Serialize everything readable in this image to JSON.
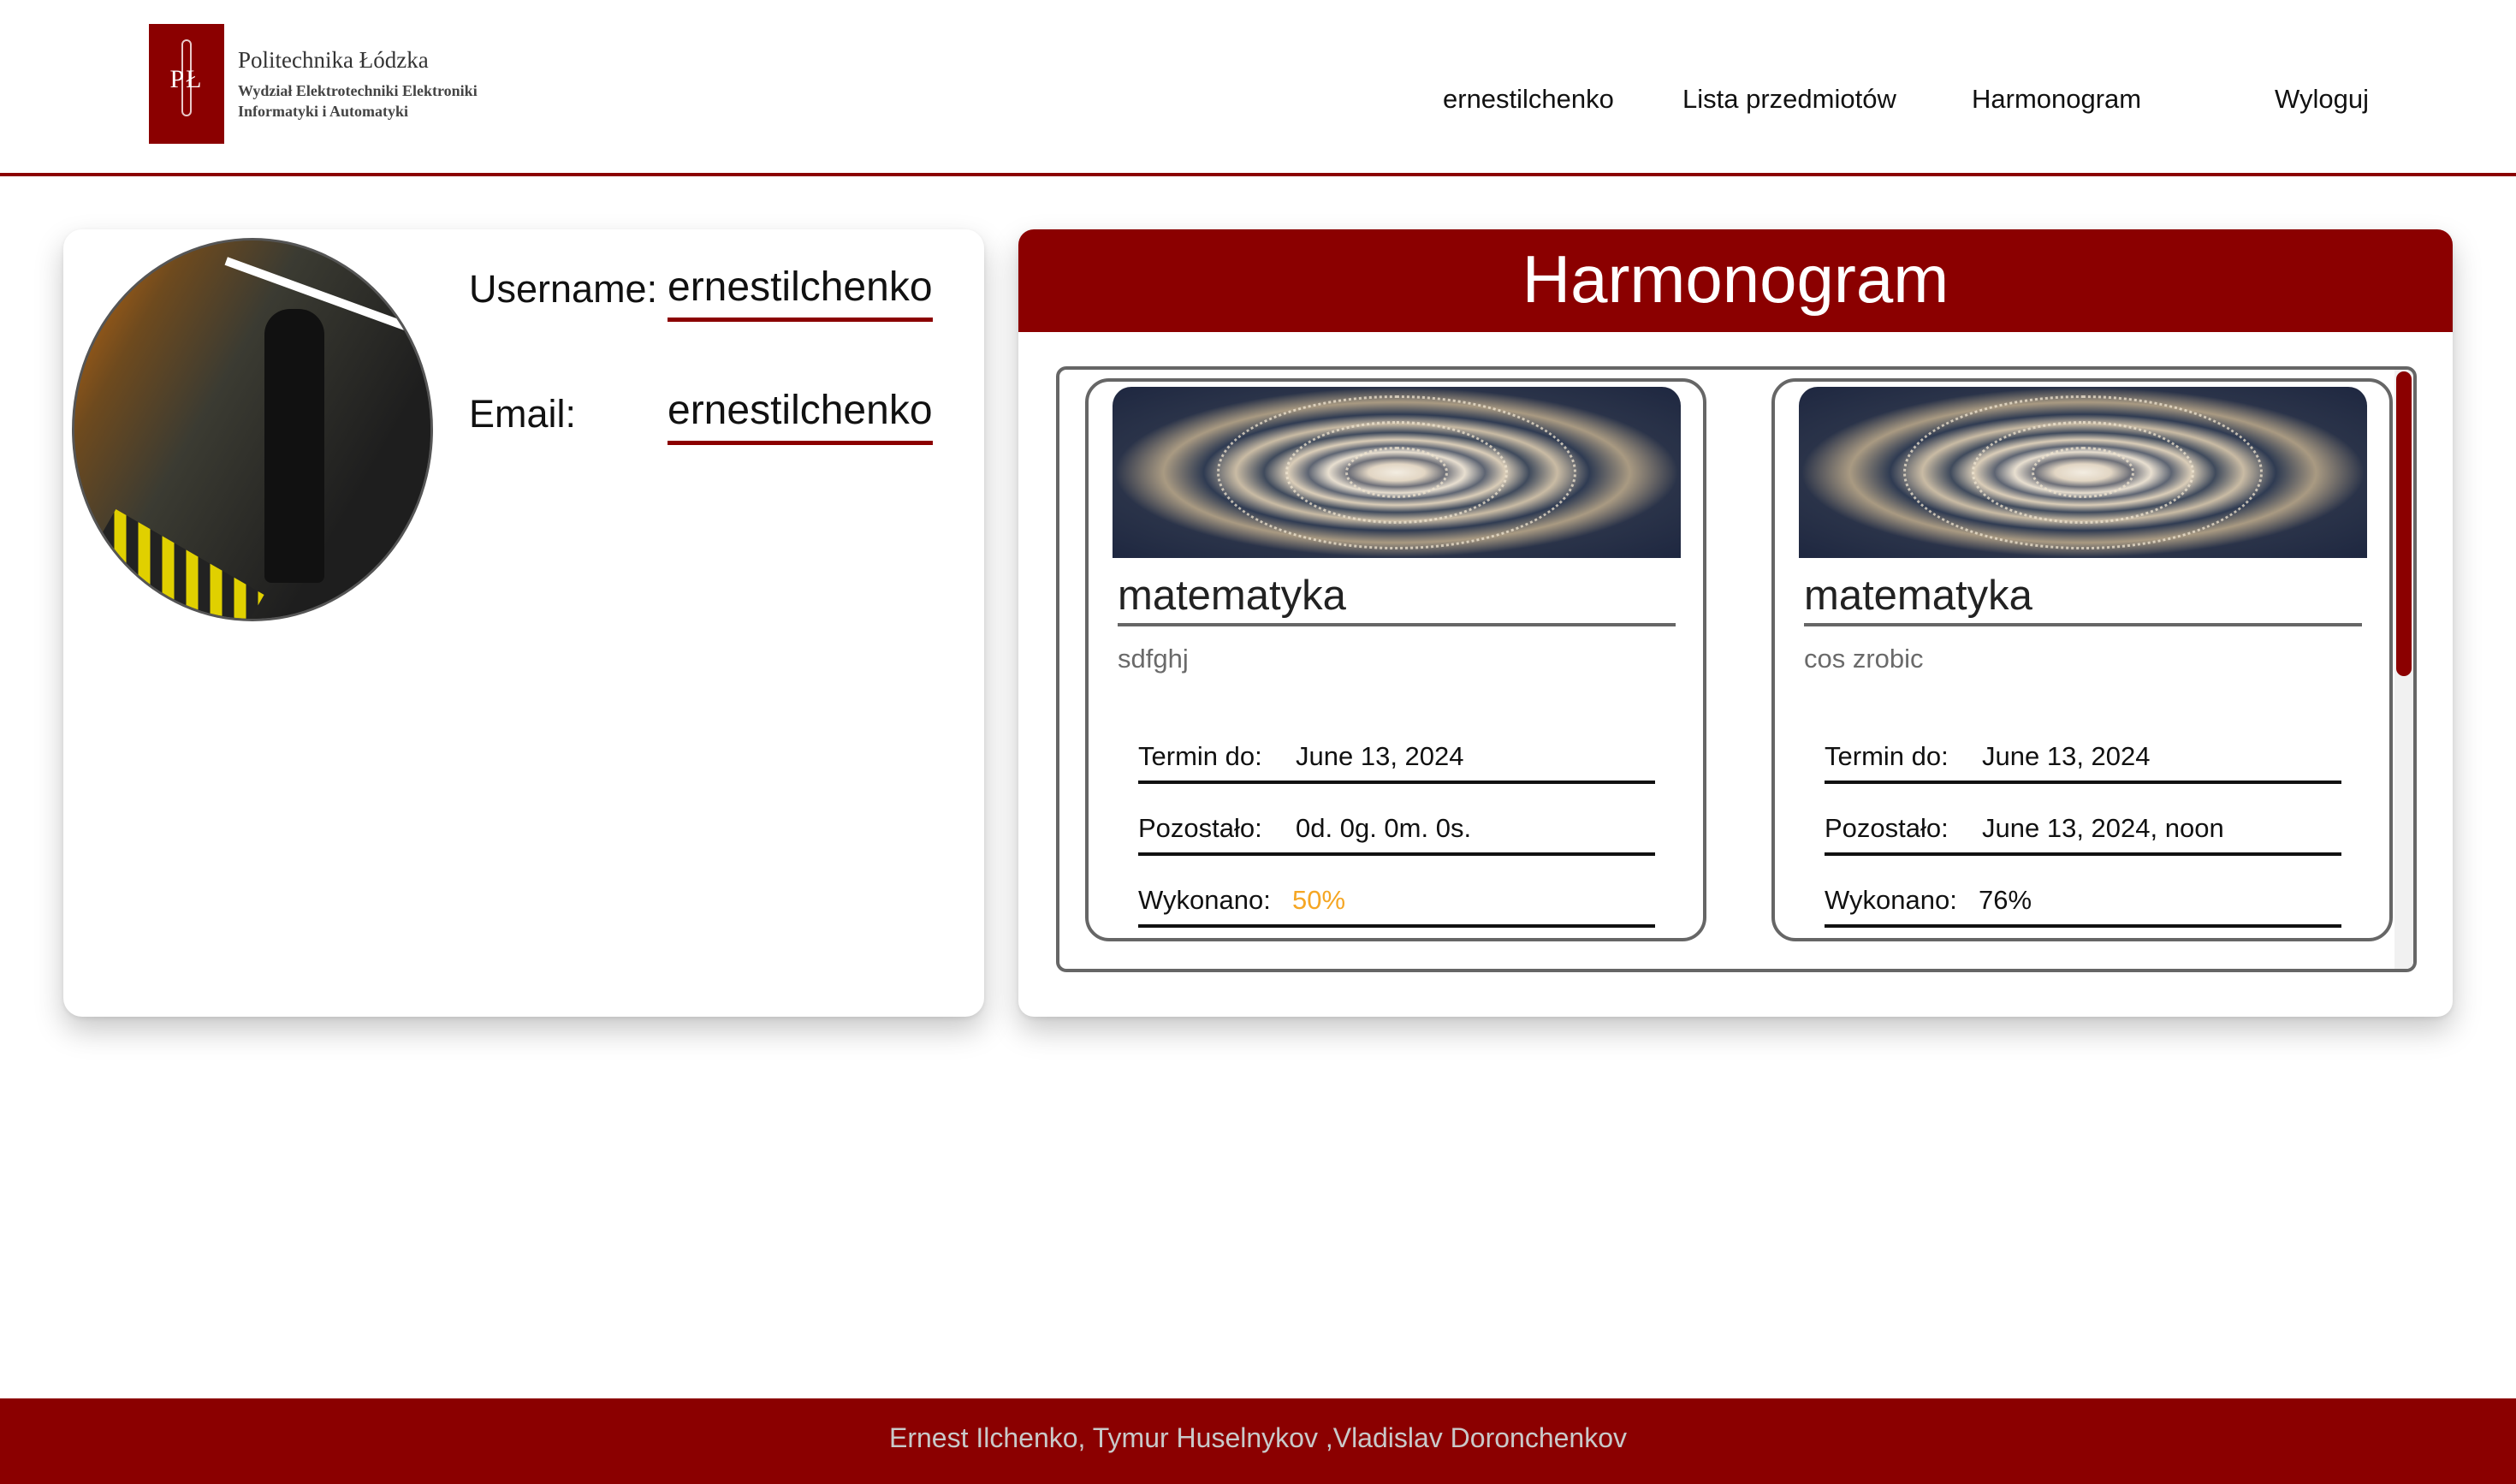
{
  "header": {
    "logo": {
      "name": "Politechnika Łódzka",
      "line2": "Wydział Elektrotechniki Elektroniki",
      "line3": "Informatyki i Automatyki",
      "mark": "PŁ"
    },
    "nav": {
      "username": "ernestilchenko",
      "subjects": "Lista przedmiotów",
      "schedule": "Harmonogram",
      "logout": "Wyloguj"
    }
  },
  "profile": {
    "username_label": "Username:",
    "username_value": "ernestilchenko",
    "email_label": "Email:",
    "email_value": "ernestilchenko"
  },
  "schedule": {
    "title": "Harmonogram",
    "tasks": [
      {
        "title": "matematyka",
        "description": "sdfghj",
        "deadline_label": "Termin do:",
        "deadline_value": "June 13, 2024",
        "remaining_label": "Pozostało:",
        "remaining_value": "0d. 0g. 0m. 0s.",
        "done_label": "Wykonano:",
        "done_value": "50%"
      },
      {
        "title": "matematyka",
        "description": "cos zrobic",
        "deadline_label": "Termin do:",
        "deadline_value": "June 13, 2024",
        "remaining_label": "Pozostało:",
        "remaining_value": "June 13, 2024, noon",
        "done_label": "Wykonano:",
        "done_value": "76%"
      }
    ]
  },
  "footer": {
    "authors": "Ernest Ilchenko, Tymur Huselnykov ,Vladislav Doronchenkov"
  },
  "colors": {
    "brand": "#8b0000",
    "accent_warning": "#f5a623"
  }
}
